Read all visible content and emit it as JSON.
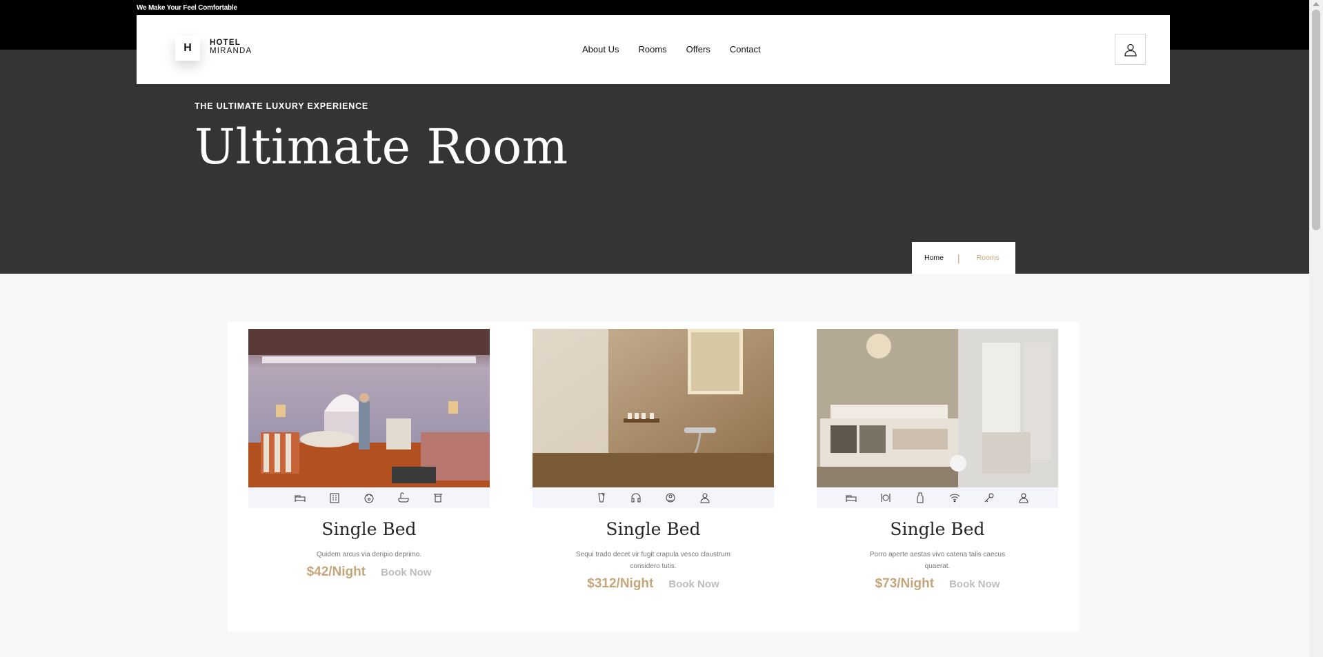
{
  "topbar": {
    "tagline": "We Make Your Feel Comfortable"
  },
  "brand": {
    "logo_letter": "H",
    "line1": "HOTEL",
    "line2": "MIRANDA"
  },
  "nav": {
    "links": [
      {
        "label": "About Us"
      },
      {
        "label": "Rooms"
      },
      {
        "label": "Offers"
      },
      {
        "label": "Contact"
      }
    ],
    "user_icon": "user-icon"
  },
  "hero": {
    "kicker": "THE ULTIMATE LUXURY EXPERIENCE",
    "title": "Ultimate Room"
  },
  "breadcrumb": {
    "home": "Home",
    "separator": "|",
    "current": "Rooms"
  },
  "colors": {
    "accent": "#c5a67a",
    "dark": "#343434",
    "black": "#000000"
  },
  "rooms": [
    {
      "title": "Single Bed",
      "description": "Quidem arcus via deripio deprimo.",
      "price": "$42/Night",
      "cta": "Book Now",
      "amenities": [
        "bed-icon",
        "building-icon",
        "safe-icon",
        "bathtub-icon",
        "towel-icon"
      ]
    },
    {
      "title": "Single Bed",
      "description": "Sequi trado decet vir fugit crapula vesco claustrum considero tutis.",
      "price": "$312/Night",
      "cta": "Book Now",
      "amenities": [
        "drink-icon",
        "headset-icon",
        "support-icon",
        "staff-icon"
      ]
    },
    {
      "title": "Single Bed",
      "description": "Porro aperte aestas vivo catena talis caecus quaerat.",
      "price": "$73/Night",
      "cta": "Book Now",
      "amenities": [
        "bed-icon",
        "dining-icon",
        "bottle-icon",
        "wifi-icon",
        "key-icon",
        "staff-icon"
      ]
    }
  ]
}
